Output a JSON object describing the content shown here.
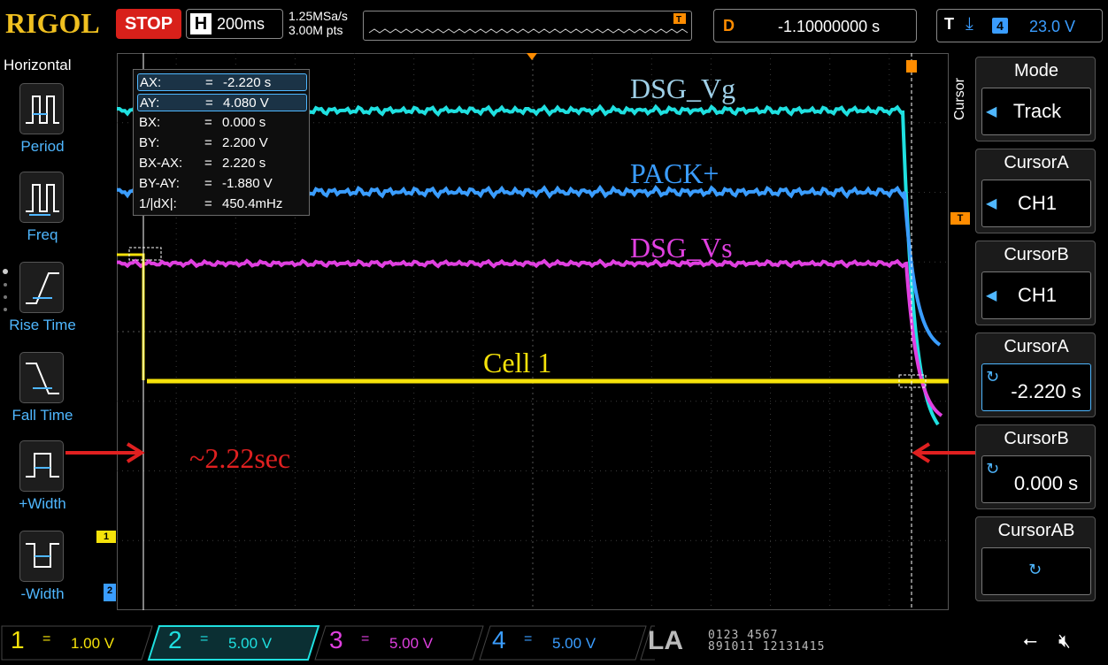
{
  "header": {
    "brand": "RIGOL",
    "run_state": "STOP",
    "horizontal_label": "H",
    "timebase": "200ms",
    "sample_rate": "1.25MSa/s",
    "memory_depth": "3.00M pts",
    "delay_label": "D",
    "delay_value": "-1.10000000 s",
    "trigger_label": "T",
    "trigger_source": "4",
    "trigger_level": "23.0 V"
  },
  "left_menu": {
    "title": "Horizontal",
    "items": [
      {
        "label": "Period",
        "icon": "period-icon"
      },
      {
        "label": "Freq",
        "icon": "freq-icon"
      },
      {
        "label": "Rise Time",
        "icon": "rise-time-icon"
      },
      {
        "label": "Fall Time",
        "icon": "fall-time-icon"
      },
      {
        "label": "+Width",
        "icon": "positive-width-icon"
      },
      {
        "label": "-Width",
        "icon": "negative-width-icon"
      }
    ]
  },
  "cursor_readout": [
    {
      "key": "AX:",
      "value": "-2.220 s",
      "highlight": true
    },
    {
      "key": "AY:",
      "value": "4.080 V",
      "highlight": true
    },
    {
      "key": "BX:",
      "value": "0.000 s",
      "highlight": false
    },
    {
      "key": "BY:",
      "value": "2.200 V",
      "highlight": false
    },
    {
      "key": "BX-AX:",
      "value": "2.220 s",
      "highlight": false
    },
    {
      "key": "BY-AY:",
      "value": "-1.880 V",
      "highlight": false
    },
    {
      "key": "1/|dX|:",
      "value": "450.4mHz",
      "highlight": false
    }
  ],
  "annotations": {
    "dsg_vg": "DSG_Vg",
    "pack_plus": "PACK+",
    "dsg_vs": "DSG_Vs",
    "cell1": "Cell 1",
    "interval": "~2.22sec"
  },
  "markers": {
    "ch1_marker": "1",
    "ch2_marker": "2",
    "trigger_marker": "T"
  },
  "right_menu": {
    "side_label": "Cursor",
    "items": [
      {
        "head": "Mode",
        "value": "Track"
      },
      {
        "head": "CursorA",
        "value": "CH1"
      },
      {
        "head": "CursorB",
        "value": "CH1"
      },
      {
        "head": "CursorA",
        "value": "-2.220 s"
      },
      {
        "head": "CursorB",
        "value": "0.000 s"
      },
      {
        "head": "CursorAB",
        "value": ""
      }
    ]
  },
  "channels": [
    {
      "num": "1",
      "coupling": "=",
      "scale": "1.00 V",
      "color": "#f5e20a"
    },
    {
      "num": "2",
      "coupling": "=",
      "scale": "5.00 V",
      "color": "#1fe0e0"
    },
    {
      "num": "3",
      "coupling": "=",
      "scale": "5.00 V",
      "color": "#e040e0"
    },
    {
      "num": "4",
      "coupling": "=",
      "scale": "5.00 V",
      "color": "#3a9dff"
    }
  ],
  "logic_analyzer": {
    "label": "LA",
    "row1": "0123 4567",
    "row2": "891011 12131415"
  },
  "colors": {
    "ch1": "#f5e20a",
    "ch2": "#1fe0e0",
    "ch3": "#e040e0",
    "ch4": "#3a9dff",
    "accent": "#4fb7ff",
    "stop": "#d8201a",
    "brand": "#f0c020",
    "trigger": "#ff8c00",
    "annotation_red": "#e02020"
  }
}
